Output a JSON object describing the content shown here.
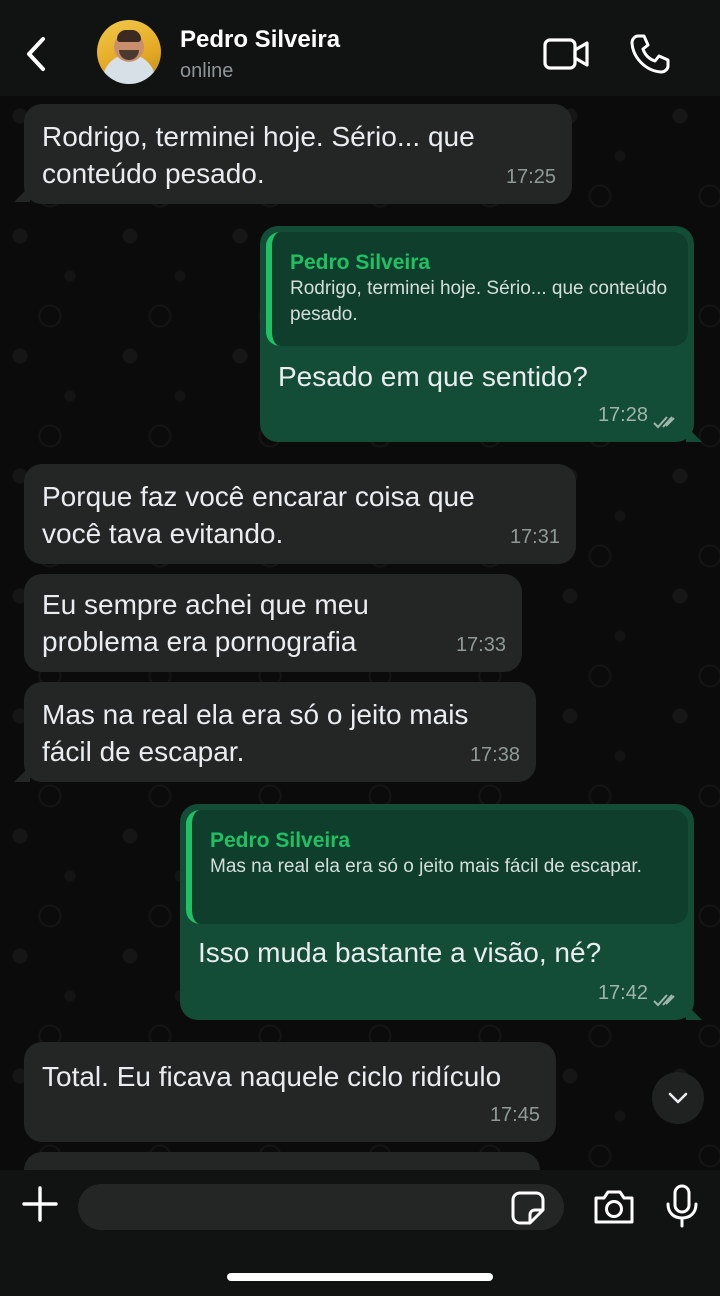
{
  "header": {
    "contact_name": "Pedro Silveira",
    "status": "online"
  },
  "messages": [
    {
      "direction": "in",
      "text": "Rodrigo, terminei hoje. Sério... que\nconteúdo pesado.",
      "time": "17:25"
    },
    {
      "direction": "out",
      "quote_name": "Pedro Silveira",
      "quote_text": "Rodrigo, terminei hoje. Sério... que conteúdo pesado.",
      "text": "Pesado em que sentido?",
      "time": "17:28",
      "status": "read"
    },
    {
      "direction": "in",
      "text": "Porque faz você encarar coisa que\nvocê tava evitando.",
      "time": "17:31"
    },
    {
      "direction": "in",
      "text": "Eu sempre achei que meu\nproblema era pornografia",
      "time": "17:33"
    },
    {
      "direction": "in",
      "text": "Mas na real ela era só o jeito mais\nfácil de escapar.",
      "time": "17:38"
    },
    {
      "direction": "out",
      "quote_name": "Pedro Silveira",
      "quote_text": "Mas na real ela era só o jeito mais fácil de escapar.",
      "text": "Isso muda bastante a visão, né?",
      "time": "17:42",
      "status": "read"
    },
    {
      "direction": "in",
      "text": "Total. Eu ficava naquele ciclo ridículo",
      "time": "17:45"
    }
  ],
  "composer": {
    "placeholder": ""
  },
  "colors": {
    "incoming_bubble": "#242626",
    "outgoing_bubble": "#144d37",
    "quote_accent": "#21c063",
    "background": "#0b0b0b"
  },
  "icons": [
    "back-arrow-icon",
    "video-camera-icon",
    "phone-icon",
    "chevron-down-icon",
    "plus-icon",
    "sticker-icon",
    "camera-icon",
    "microphone-icon",
    "double-check-icon"
  ]
}
